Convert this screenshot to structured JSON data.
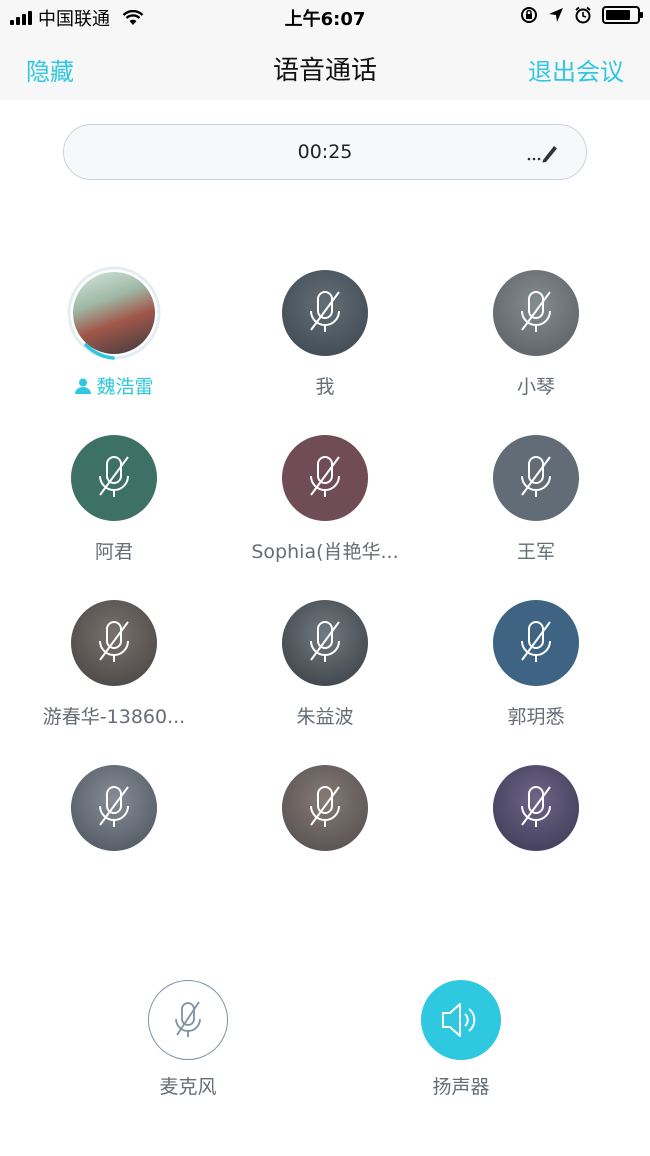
{
  "status_bar": {
    "carrier": "中国联通",
    "time": "上午6:07"
  },
  "nav": {
    "hide_label": "隐藏",
    "title": "语音通话",
    "exit_label": "退出会议"
  },
  "call": {
    "timer": "00:25",
    "edit_icon": "ellipsis-pencil-icon"
  },
  "participants": [
    {
      "name": "魏浩雷",
      "speaking": true,
      "muted": false,
      "avatar": "photo-group"
    },
    {
      "name": "我",
      "speaking": false,
      "muted": true,
      "avatar": "photo-dark"
    },
    {
      "name": "小琴",
      "speaking": false,
      "muted": true,
      "avatar": "photo-person"
    },
    {
      "name": "阿君",
      "speaking": false,
      "muted": true,
      "avatar": "color-green"
    },
    {
      "name": "Sophia(肖艳华...",
      "speaking": false,
      "muted": true,
      "avatar": "color-maroon"
    },
    {
      "name": "王军",
      "speaking": false,
      "muted": true,
      "avatar": "color-slate"
    },
    {
      "name": "游春华-13860...",
      "speaking": false,
      "muted": true,
      "avatar": "photo-face"
    },
    {
      "name": "朱益波",
      "speaking": false,
      "muted": true,
      "avatar": "photo-sunglasses"
    },
    {
      "name": "郭玥悉",
      "speaking": false,
      "muted": true,
      "avatar": "color-blue"
    },
    {
      "name": "",
      "speaking": false,
      "muted": true,
      "avatar": "photo-glasses"
    },
    {
      "name": "",
      "speaking": false,
      "muted": true,
      "avatar": "photo-woman"
    },
    {
      "name": "",
      "speaking": false,
      "muted": true,
      "avatar": "photo-purple"
    }
  ],
  "controls": {
    "mic_label": "麦克风",
    "speaker_label": "扬声器"
  },
  "colors": {
    "accent": "#2ec8e0",
    "avatar_green": "#2b6b5a",
    "avatar_maroon": "#6e3a45",
    "avatar_slate": "#5b6470",
    "avatar_blue": "#2c5a80"
  }
}
